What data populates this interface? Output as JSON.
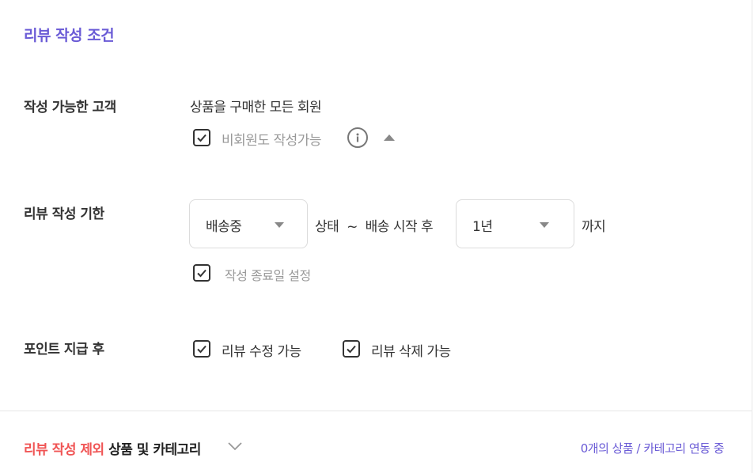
{
  "section_title": "리뷰 작성 조건",
  "eligible": {
    "label": "작성 가능한 고객",
    "description": "상품을 구매한 모든 회원",
    "guest_checkbox": {
      "label": "비회원도 작성가능",
      "checked": true
    }
  },
  "deadline": {
    "label": "리뷰 작성 기한",
    "status_select": {
      "value": "배송중"
    },
    "middle_text": "상태  ~  배송 시작 후",
    "period_select": {
      "value": "1년"
    },
    "suffix": "까지",
    "end_date_checkbox": {
      "label": "작성 종료일 설정",
      "checked": true
    }
  },
  "after_points": {
    "label": "포인트 지급 후",
    "edit_checkbox": {
      "label": "리뷰 수정 가능",
      "checked": true
    },
    "delete_checkbox": {
      "label": "리뷰 삭제 가능",
      "checked": true
    }
  },
  "exclusion": {
    "title_highlight": "리뷰 작성 제외",
    "title_rest": " 상품 및 카테고리",
    "status": "0개의 상품 / 카테고리 연동 중"
  },
  "colors": {
    "accent": "#6a5bd6",
    "highlight": "#f05555"
  }
}
